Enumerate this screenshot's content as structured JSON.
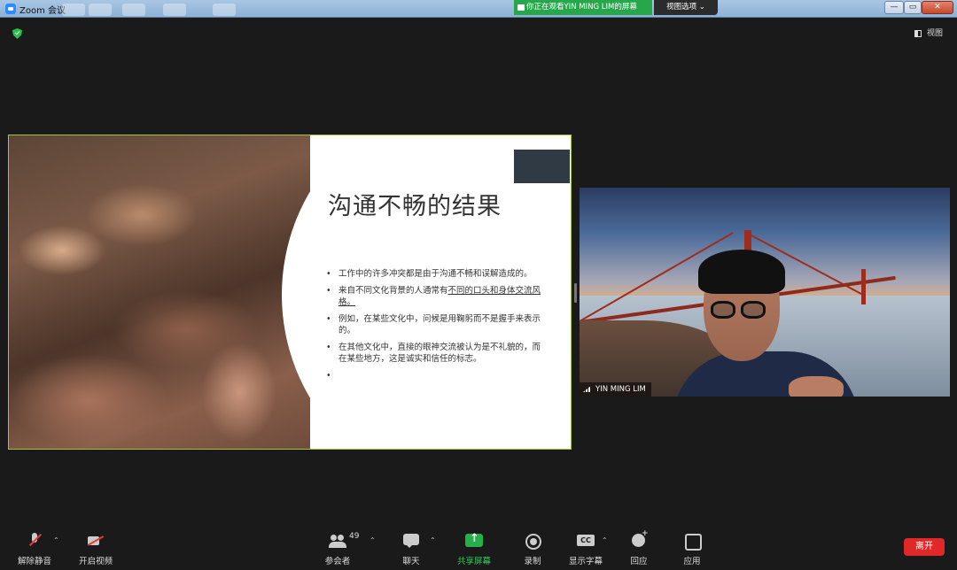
{
  "window": {
    "title": "Zoom 会议",
    "share_banner": "你正在观看YIN MING LIM的屏幕",
    "view_options": "视图选项 ⌄",
    "controls": {
      "minimize": "—",
      "maximize": "▭",
      "close": "✕"
    }
  },
  "main": {
    "view_button": "视图"
  },
  "slide": {
    "title": "沟通不畅的结果",
    "bullets": [
      {
        "plain": "工作中的许多冲突都是由于沟通不畅和误解造成的。",
        "underlined": ""
      },
      {
        "plain": "来自不同文化背景的人通常有",
        "underlined": "不同的口头和身体交流风格。"
      },
      {
        "plain": "例如，在某些文化中，问候是用鞠躬而不是握手来表示的。",
        "underlined": ""
      },
      {
        "plain": "在其他文化中，直接的眼神交流被认为是不礼貌的，而在某些地方，这是诚实和信任的标志。",
        "underlined": ""
      },
      {
        "plain": "",
        "underlined": ""
      }
    ]
  },
  "video": {
    "participant_name": "YIN MING LIM"
  },
  "toolbar": {
    "unmute": "解除静音",
    "start_video": "开启视频",
    "participants": "参会者",
    "participant_count": "49",
    "chat": "聊天",
    "share_screen": "共享屏幕",
    "record": "录制",
    "captions": "显示字幕",
    "reactions": "回应",
    "apps": "应用",
    "leave": "离开",
    "caret": "⌃"
  },
  "colors": {
    "share_green": "#26a84a",
    "leave_red": "#e02828",
    "slide_border": "#a7c33c",
    "bridge_red": "#9d2d1e"
  }
}
